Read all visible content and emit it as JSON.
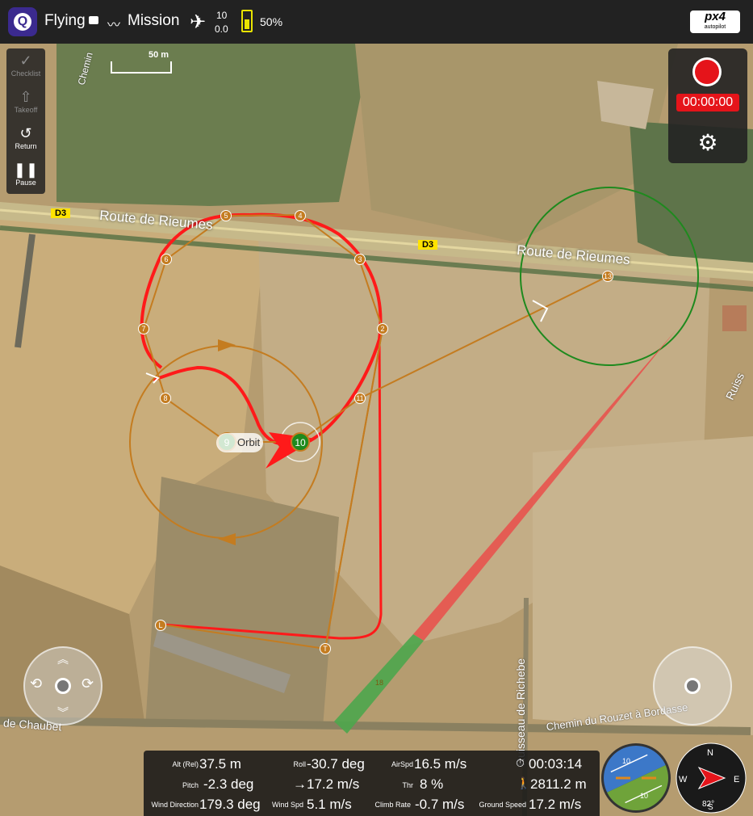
{
  "topbar": {
    "logo_letter": "Q",
    "flight_state": "Flying",
    "flight_state_icon": "message-icon",
    "mode": "Mission",
    "mode_icon": "waveform-icon",
    "gps_count": "10",
    "gps_hdop": "0.0",
    "gps_icon": "satellite-icon",
    "battery": "50%",
    "battery_level": 0.5,
    "battery_icon": "battery-icon",
    "brand": "px4",
    "brand_sub": "autopilot"
  },
  "toolstrip": {
    "items": [
      {
        "label": "Checklist",
        "icon": "checkmark-icon",
        "enabled": false
      },
      {
        "label": "Takeoff",
        "icon": "takeoff-icon",
        "enabled": false
      },
      {
        "label": "Return",
        "icon": "return-icon",
        "enabled": true
      },
      {
        "label": "Pause",
        "icon": "pause-icon",
        "enabled": true
      }
    ]
  },
  "map": {
    "scale": "50 m",
    "labels": {
      "road_main_1": "Route de Rieumes",
      "road_main_2": "Route de Rieumes",
      "road_badge_1": "D3",
      "road_badge_2": "D3",
      "chemin_top": "Chemin",
      "chemin_left": "de Chaubet",
      "chemin_right": "Chemin du Rouzet à Bordasse",
      "ruisseau": "Ruisseau de Richebe",
      "ruiss_right": "Ruiss"
    },
    "waypoints": [
      "2",
      "3",
      "4",
      "5",
      "6",
      "7",
      "8",
      "9",
      "10",
      "11",
      "13",
      "18",
      "L",
      "T"
    ],
    "orbit_label": "Orbit",
    "colors": {
      "path": "#d9822b",
      "flight_track": "#ff1a1a",
      "orbit": "#c47c20",
      "loiter": "#1e8a1e",
      "landing_red": "#e8534e",
      "landing_green": "#4da64d"
    }
  },
  "record": {
    "timer": "00:00:00",
    "record_icon": "record-icon",
    "settings_icon": "gear-icon"
  },
  "telemetry": {
    "alt_rel_label": "Alt (Rel)",
    "alt_rel": "37.5 m",
    "roll_label": "Roll",
    "roll": "-30.7 deg",
    "airspd_label": "AirSpd",
    "airspd": "16.5 m/s",
    "time_icon": "clock-icon",
    "time": "00:03:14",
    "pitch_label": "Pitch",
    "pitch": "-2.3 deg",
    "heading_icon": "arrow-right-icon",
    "heading_speed": "17.2 m/s",
    "thr_label": "Thr",
    "thr": "8 %",
    "distance_icon": "walker-icon",
    "distance": "2811.2 m",
    "wind_dir_label": "Wind Direction",
    "wind_dir": "179.3 deg",
    "wind_spd_label": "Wind Spd",
    "wind_spd": "5.1 m/s",
    "climb_label": "Climb Rate",
    "climb": "-0.7 m/s",
    "ground_label": "Ground Speed",
    "ground": "17.2 m/s"
  },
  "attitude": {
    "tick_top": "10",
    "tick_bottom": "10"
  },
  "compass": {
    "n": "N",
    "e": "E",
    "s": "S",
    "w": "W",
    "heading": "82°"
  }
}
